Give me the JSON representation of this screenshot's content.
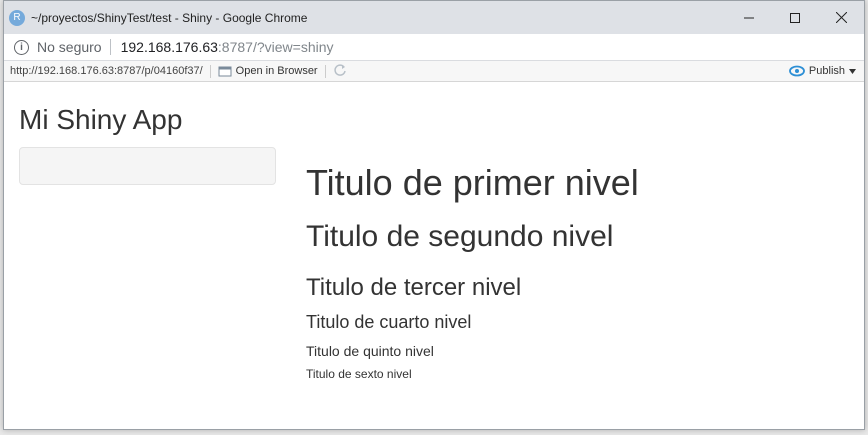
{
  "window": {
    "app_icon_letter": "R",
    "title": "~/proyectos/ShinyTest/test - Shiny - Google Chrome"
  },
  "address": {
    "not_secure": "No seguro",
    "url_host": "192.168.176.63",
    "url_rest": ":8787/?view=shiny"
  },
  "rstudio_bar": {
    "url": "http://192.168.176.63:8787/p/04160f37/",
    "open_in_browser": "Open in Browser",
    "publish": "Publish"
  },
  "app": {
    "title": "Mi Shiny App",
    "headings": {
      "h1": "Titulo de primer nivel",
      "h2": "Titulo de segundo nivel",
      "h3": "Titulo de tercer nivel",
      "h4": "Titulo de cuarto nivel",
      "h5": "Titulo de quinto nivel",
      "h6": "Titulo de sexto nivel"
    }
  },
  "colors": {
    "titlebar": "#dee1e6",
    "rstudio_blue": "#75aadb",
    "publish_blue": "#2d8fd5"
  }
}
